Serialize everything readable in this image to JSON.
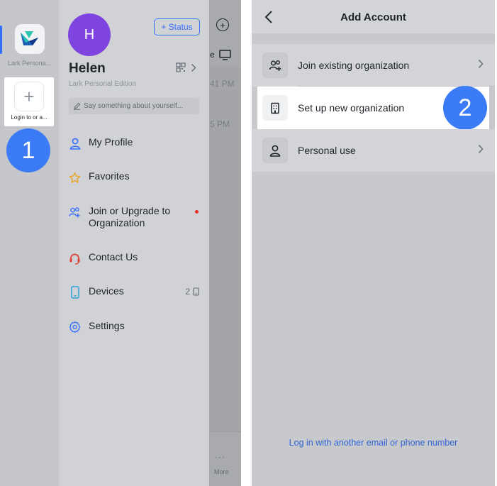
{
  "left_screen": {
    "rail": {
      "app_label": "Lark Persona...",
      "add_label": "Login to or a...",
      "add_symbol": "+"
    },
    "step_badge": "1",
    "drawer": {
      "avatar_letter": "H",
      "status_button": "+ Status",
      "user_name": "Helen",
      "edition": "Lark Personal Edition",
      "bio_placeholder": "Say something about yourself...",
      "menu": [
        {
          "label": "My Profile",
          "icon": "person-icon"
        },
        {
          "label": "Favorites",
          "icon": "star-icon"
        },
        {
          "label": "Join or Upgrade to Organization",
          "icon": "people-add-icon",
          "badge": "red-dot"
        },
        {
          "label": "Contact Us",
          "icon": "headset-icon"
        },
        {
          "label": "Devices",
          "icon": "phone-icon",
          "count": "2"
        },
        {
          "label": "Settings",
          "icon": "gear-icon"
        }
      ]
    },
    "background": {
      "partial_letter": "e",
      "time_1": "41 PM",
      "time_2": "5 PM",
      "more_label": "More"
    }
  },
  "right_screen": {
    "title": "Add Account",
    "options": [
      {
        "label": "Join existing organization",
        "icon": "people-add-icon",
        "chevron": true
      },
      {
        "label": "Set up new organization",
        "icon": "building-icon",
        "highlighted": true
      },
      {
        "label": "Personal use",
        "icon": "person-icon",
        "chevron": true
      }
    ],
    "step_badge": "2",
    "footer_link": "Log in with another email or phone number"
  },
  "colors": {
    "accent": "#3370ff",
    "avatar": "#7f43e0",
    "step_badge": "#3b7cf6",
    "notification_dot": "#e22e28",
    "link": "#2f62d5",
    "star": "#e8a520",
    "headset": "#e03b2e",
    "devices": "#2fa4d8"
  }
}
